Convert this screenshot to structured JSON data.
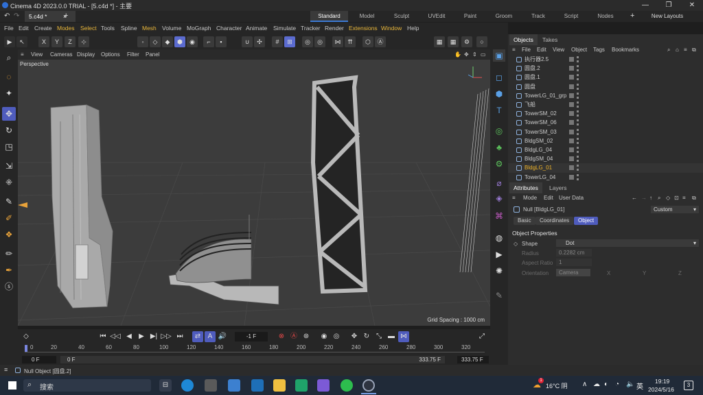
{
  "window": {
    "title": "Cinema 4D 2023.0.0 TRIAL - [5.c4d *] - 主要",
    "doc_tab": "5.c4d *",
    "layouts": [
      "Standard",
      "Model",
      "Sculpt",
      "UVEdit",
      "Paint",
      "Groom",
      "Track",
      "Script",
      "Nodes"
    ],
    "new_layouts": "New Layouts"
  },
  "menus": [
    "File",
    "Edit",
    "Create",
    "Modes",
    "Select",
    "Tools",
    "Spline",
    "Mesh",
    "Volume",
    "MoGraph",
    "Character",
    "Animate",
    "Simulate",
    "Tracker",
    "Render",
    "Extensions",
    "Window",
    "Help"
  ],
  "viewport": {
    "menus": [
      "View",
      "Cameras",
      "Display",
      "Options",
      "Filter",
      "Panel"
    ],
    "label": "Perspective",
    "grid_spacing": "Grid Spacing : 1000 cm"
  },
  "objects_panel": {
    "tabs": [
      "Objects",
      "Takes"
    ],
    "menus": [
      "File",
      "Edit",
      "View",
      "Object",
      "Tags",
      "Bookmarks"
    ],
    "items": [
      "执行器2.5",
      "圆盘.2",
      "圆盘.1",
      "圆盘",
      "TowerLG_01_grp",
      "飞船",
      "TowerSM_02",
      "TowerSM_06",
      "TowerSM_03",
      "BldgSM_02",
      "BldgLG_04",
      "BldgSM_04",
      "BldgLG_01",
      "TowerLG_04"
    ],
    "selected": "BldgLG_01"
  },
  "attributes": {
    "tabs": [
      "Attributes",
      "Layers"
    ],
    "menus": [
      "Mode",
      "Edit",
      "User Data"
    ],
    "object_name": "Null [BldgLG_01]",
    "preset": "Custom",
    "subtabs": [
      "Basic",
      "Coordinates",
      "Object"
    ],
    "section": "Object Properties",
    "shape_label": "Shape",
    "shape_value": "Dot",
    "radius_label": "Radius",
    "radius_value": "0.2282 cm",
    "aspect_label": "Aspect Ratio",
    "aspect_value": "1",
    "orientation_label": "Orientation",
    "orientation_value": "Camera",
    "axes": [
      "X",
      "Y",
      "Z"
    ]
  },
  "timeline": {
    "current_frame": "-1 F",
    "ticks": [
      "0",
      "20",
      "40",
      "60",
      "80",
      "100",
      "120",
      "140",
      "160",
      "180",
      "200",
      "220",
      "240",
      "260",
      "280",
      "300",
      "320"
    ],
    "start": "0 F",
    "start2": "0 F",
    "end": "333.75 F",
    "end2": "333.75 F"
  },
  "status": "Null Object [圆盘.2]",
  "taskbar": {
    "search": "搜索",
    "weather": "16°C 阴",
    "weather_badge": "1",
    "ime": "英",
    "time": "19:19",
    "date": "2024/5/16",
    "notif": "3"
  }
}
